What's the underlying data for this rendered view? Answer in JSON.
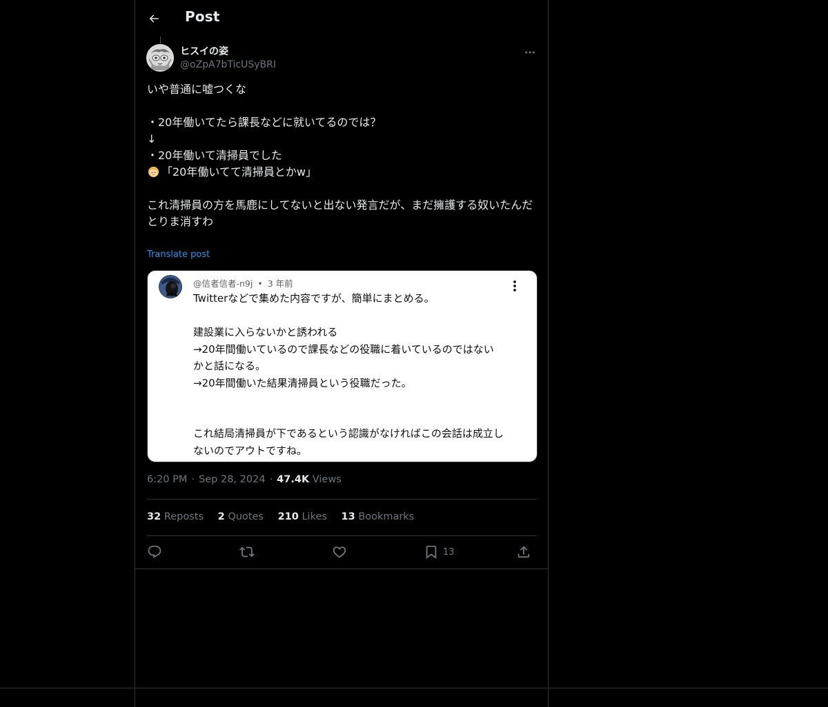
{
  "header": {
    "title": "Post",
    "back_icon": "arrow-left-icon"
  },
  "post": {
    "author": {
      "display_name": "ヒスイの姿",
      "handle": "@oZpA7bTicUSyBRI",
      "avatar_icon": "avatar-image"
    },
    "more_icon": "more-horizontal-icon",
    "text_lines": [
      "いや普通に嘘つくな",
      "",
      "・20年働いてたら課長などに就いてるのでは？",
      "↓",
      "・20年働いて清掃員でした",
      "「20年働いてて清掃員とかw」",
      "",
      "これ清掃員の方を馬鹿にしてないと出ない発言だが、まだ擁護する奴いたんだ",
      "とりま消すわ"
    ],
    "emoji_icon": "person-blond-hair-emoji",
    "translate_label": "Translate post",
    "embedded_image": {
      "author": "@信者信者-n9j",
      "age": "3 年前",
      "separator": "•",
      "kebab_icon": "more-vertical-icon",
      "lines": [
        "Twitterなどで集めた内容ですが、簡単にまとめる。",
        "",
        "建設業に入らないかと誘われる",
        "→20年間働いているので課長などの役職に着いているのではない",
        "かと話になる。",
        "→20年間働いた結果清掃員という役職だった。",
        "",
        "",
        "これ結局清掃員が下であるという認識がなければこの会話は成立し",
        "ないのでアウトですね。"
      ]
    },
    "time": "6:20 PM",
    "date": "Sep 28, 2024",
    "views_count": "47.4K",
    "views_label": "Views",
    "dot": "·",
    "stats": {
      "reposts_count": "32",
      "reposts_label": "Reposts",
      "quotes_count": "2",
      "quotes_label": "Quotes",
      "likes_count": "210",
      "likes_label": "Likes",
      "bookmarks_count": "13",
      "bookmarks_label": "Bookmarks"
    },
    "actions": {
      "reply_icon": "reply-icon",
      "repost_icon": "repost-icon",
      "like_icon": "heart-icon",
      "bookmark_icon": "bookmark-icon",
      "bookmark_count": "13",
      "share_icon": "share-icon"
    }
  },
  "colors": {
    "background": "#000000",
    "text": "#e7e9ea",
    "secondary_text": "#71767b",
    "link": "#1d9bf0",
    "border": "#2f3336"
  }
}
